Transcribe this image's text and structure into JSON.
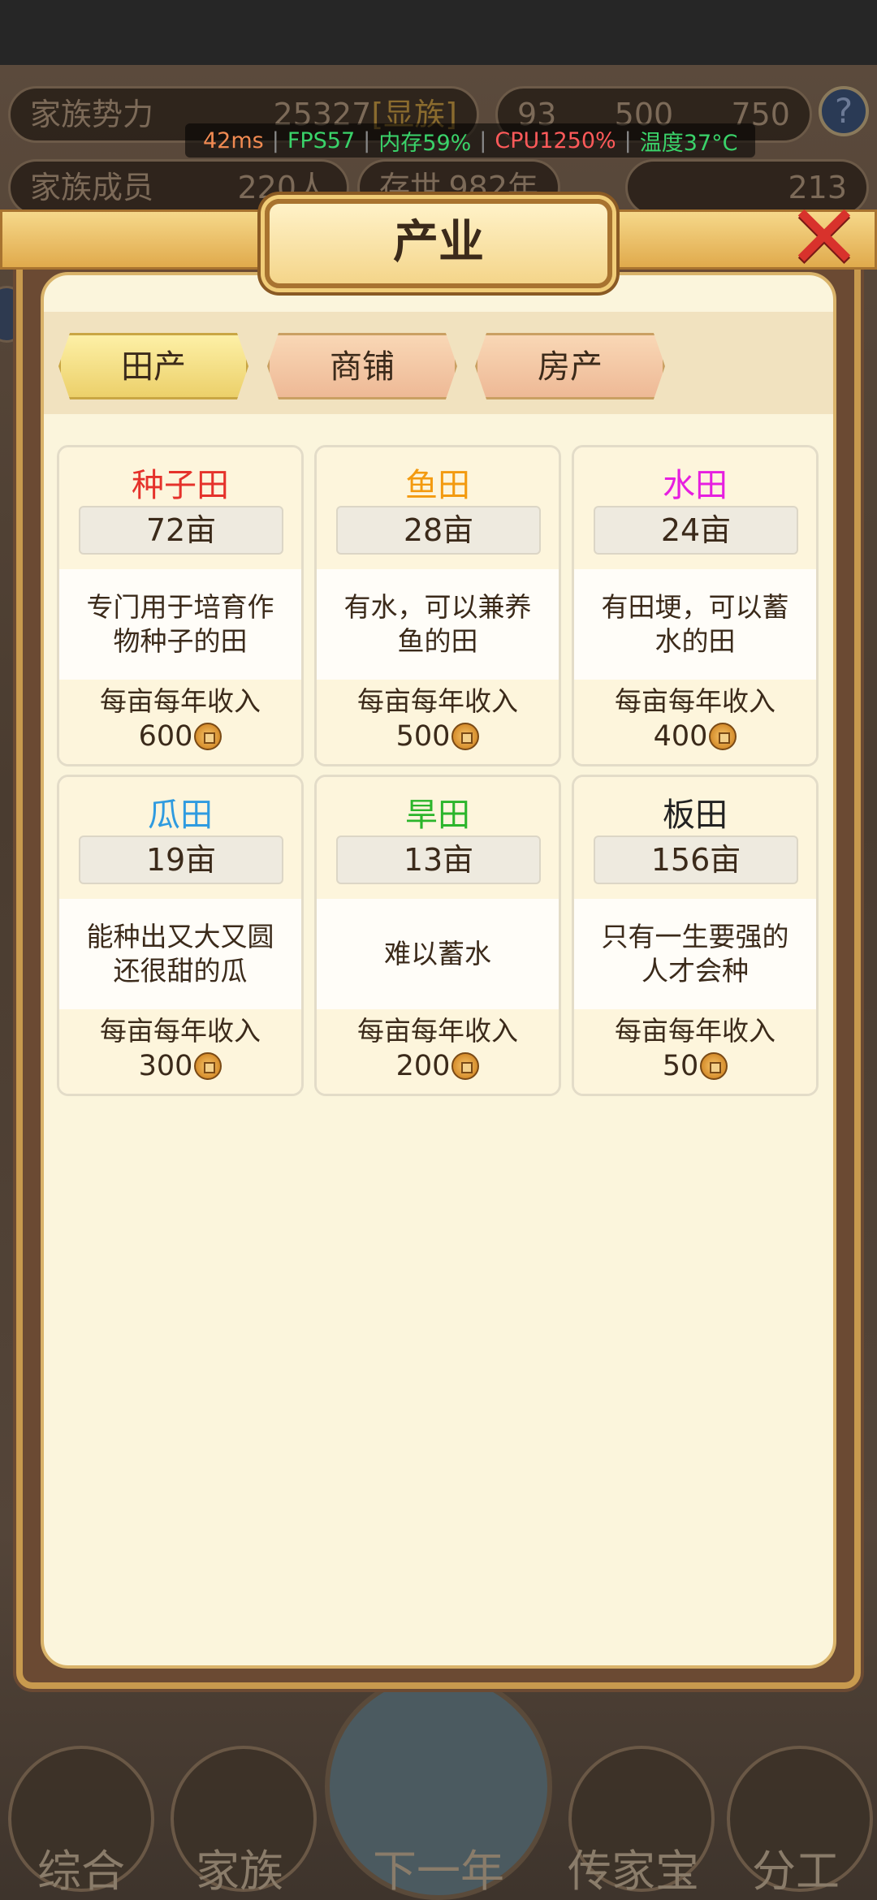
{
  "perf": {
    "ping": "42ms",
    "fps": "FPS57",
    "memory": "内存59%",
    "cpu": "CPU1250%",
    "temp": "温度37°C",
    "separator": "|"
  },
  "background": {
    "influence_label": "家族势力",
    "influence_value": "25327",
    "influence_rank": "[显族]",
    "members_label": "家族成员",
    "members_value": "220人",
    "alive_label": "存世",
    "alive_value": "982年",
    "resource_a": "93",
    "resource_b": "500",
    "resource_c": "750",
    "gold_value": "213",
    "help": "?",
    "nav": [
      "综合",
      "家族",
      "下一年",
      "传家宝",
      "分工"
    ]
  },
  "panel": {
    "title": "产业",
    "close_icon": "close-x-icon",
    "tabs": [
      {
        "label": "田产",
        "active": true
      },
      {
        "label": "商铺",
        "active": false
      },
      {
        "label": "房产",
        "active": false
      }
    ],
    "income_label": "每亩每年收入",
    "coin_icon": "copper-coin-icon",
    "cards": [
      {
        "name": "种子田",
        "color": "#e5322b",
        "qty": "72亩",
        "desc": "专门用于培育作物种子的田",
        "income": "600"
      },
      {
        "name": "鱼田",
        "color": "#f39a0f",
        "qty": "28亩",
        "desc": "有水，可以兼养鱼的田",
        "income": "500"
      },
      {
        "name": "水田",
        "color": "#e61fe0",
        "qty": "24亩",
        "desc": "有田埂，可以蓄水的田",
        "income": "400"
      },
      {
        "name": "瓜田",
        "color": "#2f9be0",
        "qty": "19亩",
        "desc": "能种出又大又圆还很甜的瓜",
        "income": "300"
      },
      {
        "name": "旱田",
        "color": "#2bb52b",
        "qty": "13亩",
        "desc": "难以蓄水",
        "income": "200"
      },
      {
        "name": "板田",
        "color": "#222222",
        "qty": "156亩",
        "desc": "只有一生要强的人才会种",
        "income": "50"
      }
    ]
  }
}
